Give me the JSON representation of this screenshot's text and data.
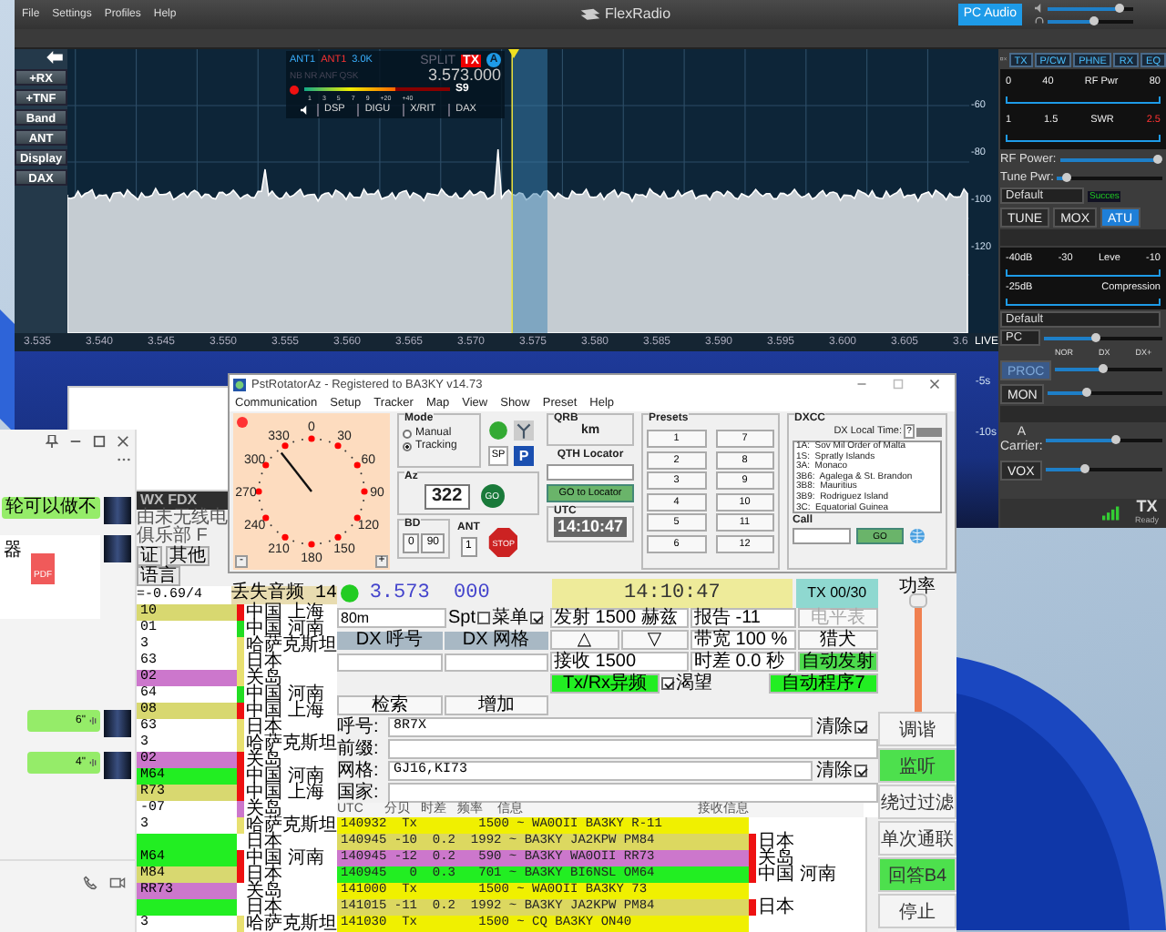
{
  "flexradio": {
    "menu": [
      "File",
      "Settings",
      "Profiles",
      "Help"
    ],
    "title": "FlexRadio",
    "pc_audio": "PC Audio",
    "speaker": {
      "level": 0.85
    },
    "headphone": {
      "level": 0.55
    },
    "side_buttons": [
      "+RX",
      "+TNF",
      "Band",
      "ANT",
      "Display",
      "DAX"
    ],
    "slice": {
      "rx_ant": "ANT1",
      "tx_ant": "ANT1",
      "filter": "3.0K",
      "flags": [
        "NB",
        "NR",
        "ANF",
        "QSK"
      ],
      "split": "SPLIT",
      "tx": "TX",
      "letter": "A",
      "frequency": "3.573.000",
      "meter_ticks": [
        "1",
        "3",
        "5",
        "7",
        "9",
        "+20",
        "+40"
      ],
      "s_reading": "S9",
      "level": 0.62,
      "buttons": [
        "DSP",
        "DIGU",
        "X/RIT",
        "DAX"
      ]
    },
    "db_scale": [
      "-60",
      "-80",
      "-100",
      "-120"
    ],
    "freq_axis": [
      "3.535",
      "3.540",
      "3.545",
      "3.550",
      "3.555",
      "3.560",
      "3.565",
      "3.570",
      "3.575",
      "3.580",
      "3.585",
      "3.590",
      "3.595",
      "3.600",
      "3.605"
    ],
    "axis_end": "3.6",
    "live": "LIVE",
    "waterfall_scale": [
      "-5s",
      "-10s"
    ],
    "panel": {
      "tabs": [
        "TX",
        "P/CW",
        "PHNE",
        "RX",
        "EQ"
      ],
      "rf_ticks": [
        "0",
        "40",
        "RF Pwr",
        "80"
      ],
      "swr_ticks": [
        "1",
        "1.5",
        "SWR",
        "2.5"
      ],
      "rf_power": {
        "label": "RF Power:",
        "level": 0.97
      },
      "tune_power": {
        "label": "Tune Pwr:",
        "level": 0.1
      },
      "profile": "Default",
      "atu_status": "Succes",
      "tune": "TUNE",
      "mox": "MOX",
      "atu": {
        "label": "ATU",
        "on": true
      },
      "level_ticks": [
        "-40dB",
        "-30",
        "Leve",
        "-10"
      ],
      "comp_ticks": [
        "-25dB",
        "Compression"
      ],
      "mic_profile": "Default",
      "mic_source": "PC",
      "mic_slider": {
        "level": 0.45
      },
      "proc_ticks": [
        "NOR",
        "DX",
        "DX+"
      ],
      "proc": {
        "label": "PROC",
        "on": false
      },
      "proc_slider": {
        "level": 0.45
      },
      "mon": "MON",
      "mon_slider": {
        "level": 0.35
      },
      "carrier_prefix": "A",
      "carrier": "Carrier:",
      "carrier_slider": {
        "level": 0.6
      },
      "vox": "VOX",
      "vox_slider": {
        "level": 0.35
      },
      "status": "TX",
      "status_sub": "Ready"
    }
  },
  "rotator": {
    "title": "PstRotatorAz - Registered to BA3KY   v14.73",
    "menu": [
      "Communication",
      "Setup",
      "Tracker",
      "Map",
      "View",
      "Show",
      "Preset",
      "Help"
    ],
    "compass_labels": [
      "0",
      "30",
      "60",
      "90",
      "120",
      "150",
      "180",
      "210",
      "240",
      "270",
      "300",
      "330"
    ],
    "zoom_out": "-",
    "zoom_in": "+",
    "mode_label": "Mode",
    "modes": [
      {
        "label": "Manual",
        "selected": false
      },
      {
        "label": "Tracking",
        "selected": true
      }
    ],
    "sp": "SP",
    "park": "P",
    "az_label": "Az",
    "azimuth": "322",
    "go": "GO",
    "bd_label": "BD",
    "bd_buttons": [
      "0",
      "90"
    ],
    "ant_label": "ANT",
    "ant": "1",
    "stop": "STOP",
    "qrb_label": "QRB",
    "qrb": "km",
    "qth_label": "QTH Locator",
    "go_locator": "GO to Locator",
    "utc_label": "UTC",
    "utc": "14:10:47",
    "presets_label": "Presets",
    "presets": [
      "1",
      "2",
      "3",
      "4",
      "5",
      "6",
      "7",
      "8",
      "9",
      "10",
      "11",
      "12"
    ],
    "dxcc_label": "DXCC",
    "dx_local_time": "DX Local Time:",
    "dx_help": "?",
    "dxcc_list": [
      "1A:  Sov Mil Order of Malta",
      "1S:  Spratly Islands",
      "3A:  Monaco",
      "3B6:  Agalega & St. Brandon",
      "3B8:  Mauritius",
      "3B9:  Rodriguez Island",
      "3C:  Equatorial Guinea"
    ],
    "call_label": "Call",
    "call_go": "GO"
  },
  "chat": {
    "bubbles": [
      {
        "kind": "text",
        "text": "轮可以做不"
      },
      {
        "kind": "file",
        "text": "器",
        "icon": "PDF"
      },
      {
        "kind": "voice",
        "text": "6\""
      },
      {
        "kind": "voice",
        "text": "4\""
      }
    ]
  },
  "jtdx": {
    "title": "WX FDX",
    "subtitle": "由未无线电俱乐部 F",
    "tabs": [
      "证",
      "其他",
      "语言"
    ],
    "drift": "=-0.69/4",
    "lost_audio": "丢失音频 14",
    "band_rows": [
      {
        "call": "10",
        "color": "#d8d870",
        "flag": {
          "color": "#ee1111"
        },
        "country": "中国 上海"
      },
      {
        "call": "01",
        "color": "#ffffff",
        "flag": {
          "color": "#22dd22"
        },
        "country": "中国 河南"
      },
      {
        "call": "3",
        "color": "#ffffff",
        "flag": {
          "color": "#e8e070"
        },
        "country": "哈萨克斯坦"
      },
      {
        "call": "63",
        "color": "#ffffff",
        "flag": {
          "color": "#e8e070"
        },
        "country": "日本"
      },
      {
        "call": "02",
        "color": "#cc77cc",
        "flag": {
          "color": "#e8e070"
        },
        "country": "关岛"
      },
      {
        "call": "64",
        "color": "#ffffff",
        "flag": {
          "color": "#22dd22"
        },
        "country": "中国 河南"
      },
      {
        "call": "08",
        "color": "#d8d870",
        "flag": {
          "color": "#ee1111"
        },
        "country": "中国 上海"
      },
      {
        "call": "63",
        "color": "#ffffff",
        "flag": {
          "color": "#e8e070"
        },
        "country": "日本"
      },
      {
        "call": "3",
        "color": "#ffffff",
        "flag": {
          "color": "#e8e070"
        },
        "country": "哈萨克斯坦"
      },
      {
        "call": "02",
        "color": "#cc77cc",
        "flag": {
          "color": "#ee1111"
        },
        "country": "关岛"
      },
      {
        "call": "M64",
        "color": "#22ee22",
        "flag": {
          "color": "#ee1111"
        },
        "country": "中国 河南"
      },
      {
        "call": "R73",
        "color": "#d8d870",
        "flag": {
          "color": "#ee1111"
        },
        "country": "中国 上海"
      },
      {
        "call": "-07",
        "color": "#ffffff",
        "flag": {
          "color": "#cc77cc"
        },
        "country": "关岛"
      },
      {
        "call": "3",
        "color": "#ffffff",
        "flag": {
          "color": "#e8e070"
        },
        "country": "哈萨克斯坦"
      },
      {
        "call": "",
        "color": "#22ee22",
        "country": "日本"
      },
      {
        "call": "M64",
        "color": "#22ee22",
        "flag": {
          "color": "#ee1111"
        },
        "country": "中国 河南"
      },
      {
        "call": "M84",
        "color": "#d8d870",
        "flag": {
          "color": "#ee1111"
        },
        "country": "日本"
      },
      {
        "call": "RR73",
        "color": "#cc77cc",
        "country": "关岛"
      },
      {
        "call": "",
        "color": "#22ee22",
        "country": "日本"
      },
      {
        "call": "3",
        "color": "#ffffff",
        "flag": {
          "color": "#e8e070"
        },
        "country": "哈萨克斯坦"
      }
    ],
    "frequency": "3.573  000",
    "time": "14:10:47",
    "tx_counter": "TX 00/30",
    "band": "80m",
    "spt": {
      "label": "Spt",
      "checked": false
    },
    "menu_cb": {
      "label": "菜单",
      "checked": true
    },
    "tx_freq": "发射 1500 赫兹",
    "report": "报告 -11",
    "meter": {
      "label": "电平表",
      "disabled": true
    },
    "dx_call_header": "DX 呼号",
    "dx_grid_header": "DX 网格",
    "up": "△",
    "down": "▽",
    "bandwidth": "带宽 100 %",
    "hound": "猎犬",
    "rx_freq": "接收 1500",
    "dt": "时差 0.0 秒",
    "auto_tx": "自动发射",
    "split": "Tx/Rx异频",
    "want": {
      "label": "渴望",
      "checked": true
    },
    "auto_seq": "自动程序7",
    "search": "检索",
    "add": "增加",
    "fields": [
      {
        "label": "呼号:",
        "value": "8R7X",
        "clear": "清除",
        "checked": true
      },
      {
        "label": "前缀:"
      },
      {
        "label": "网格:",
        "value": "GJ16,KI73",
        "clear": "清除",
        "checked": true
      },
      {
        "label": "国家:"
      }
    ],
    "table_headers": [
      "UTC",
      "分贝",
      "时差",
      "频率",
      "信息",
      "接收信息"
    ],
    "decodes": [
      {
        "text": "140932  Tx        1500 ~ WA0OII BA3KY R-11",
        "color": "#f0f000"
      },
      {
        "text": "140945 -10  0.2  1992 ~ BA3KY JA2KPW PM84",
        "color": "#dcd860",
        "flag": {
          "color": "#ee1111"
        },
        "country": "日本"
      },
      {
        "text": "140945 -12  0.2   590 ~ BA3KY WA0OII RR73",
        "color": "#cc77cc",
        "flag": {
          "color": "#ee1111"
        },
        "country": "关岛"
      },
      {
        "text": "140945   0  0.3   701 ~ BA3KY BI6NSL OM64",
        "color": "#22ee22",
        "flag": {
          "color": "#ee1111"
        },
        "country": "中国 河南"
      },
      {
        "text": "141000  Tx        1500 ~ WA0OII BA3KY 73",
        "color": "#f0f000"
      },
      {
        "text": "141015 -11  0.2  1992 ~ BA3KY JA2KPW PM84",
        "color": "#dcd860",
        "flag": {
          "color": "#ee1111"
        },
        "country": "日本"
      },
      {
        "text": "141030  Tx        1500 ~ CQ BA3KY ON40",
        "color": "#f0f000"
      }
    ],
    "power_label": "功率",
    "power": {
      "level": 1.0
    },
    "buttons": [
      {
        "label": "调谐",
        "on": false
      },
      {
        "label": "监听",
        "on": true
      },
      {
        "label": "绕过过滤",
        "on": false
      },
      {
        "label": "单次通联",
        "on": false
      },
      {
        "label": "回答B4",
        "on": true
      },
      {
        "label": "停止",
        "on": false
      }
    ]
  }
}
